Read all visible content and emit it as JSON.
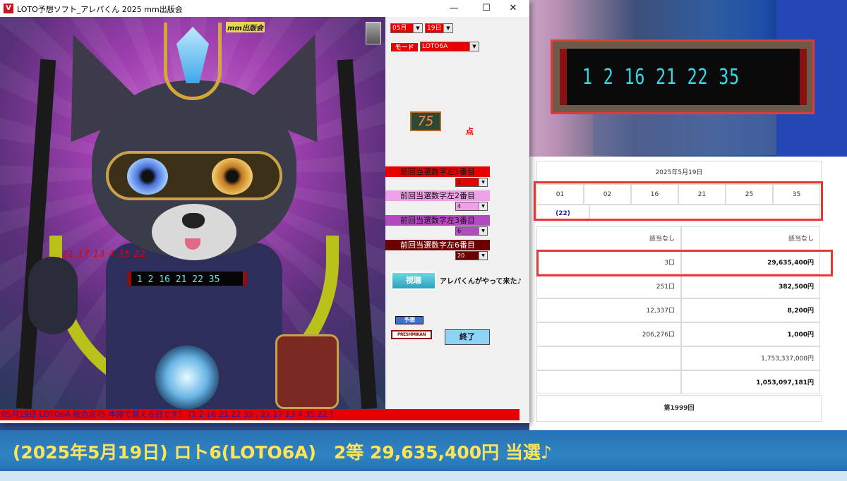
{
  "window": {
    "title": "LOTO予想ソフト_アレパくん 2025  mm出版会",
    "icon_text": "V",
    "minimize": "—",
    "maximize": "☐",
    "close": "✕"
  },
  "art": {
    "label": "mm出版会",
    "prediction_text": "21 17 13 4 35 22",
    "display_numbers": "1 2 16 21 22 35"
  },
  "controls": {
    "month": "05月",
    "day": "19日",
    "mode_label": "モード",
    "mode_value": "LOTO6A",
    "score": "75",
    "score_unit": "点",
    "prev_numbers": [
      {
        "label": "前回当選数字左1番目",
        "value": "1",
        "bg": "#e60000",
        "fg": "#111111"
      },
      {
        "label": "前回当選数字左2番目",
        "value": "4",
        "bg": "#f0a0e6",
        "fg": "#111111"
      },
      {
        "label": "前回当選数字左3番目",
        "value": "6",
        "bg": "#b44ac2",
        "fg": "#111111"
      },
      {
        "label": "前回当選数字左6番目",
        "value": "20",
        "bg": "#6a0000",
        "fg": "#ffffff"
      }
    ],
    "watch_button": "視聴",
    "arrival_text": "アレパくんがやって来た♪",
    "predict_button": "予想",
    "feature_button": "PRESHMIKAN",
    "end_button": "終了"
  },
  "status_strip": "05月19日 LOTO6A 総合点75 本線で買える日です！ [1 2 16 21 22 35 , 21 17 13 4 35 22 ]",
  "video": {
    "numbers": "1 2 16 21 22 35"
  },
  "results": {
    "date": "2025年5月19日",
    "numbers": [
      "01",
      "02",
      "16",
      "21",
      "25",
      "35"
    ],
    "bonus": "(22)",
    "rows": [
      {
        "count": "該当なし",
        "prize": "該当なし",
        "bold": false
      },
      {
        "count": "3口",
        "prize": "29,635,400円",
        "bold": true
      },
      {
        "count": "251口",
        "prize": "382,500円",
        "bold": true
      },
      {
        "count": "12,337口",
        "prize": "8,200円",
        "bold": true
      },
      {
        "count": "206,276口",
        "prize": "1,000円",
        "bold": true
      },
      {
        "count": "",
        "prize": "1,753,337,000円",
        "bold": false
      },
      {
        "count": "",
        "prize": "1,053,097,181円",
        "bold": true
      }
    ],
    "next_round": "第1999回"
  },
  "caption": "(2025年5月19日) ロト6(LOTO6A)　2等 29,635,400円  当選♪",
  "colors": {
    "accent_red": "#e60000",
    "highlight_box": "#e53935",
    "caption_text": "#ffe45a",
    "banner_blue": "#2e84c3"
  }
}
